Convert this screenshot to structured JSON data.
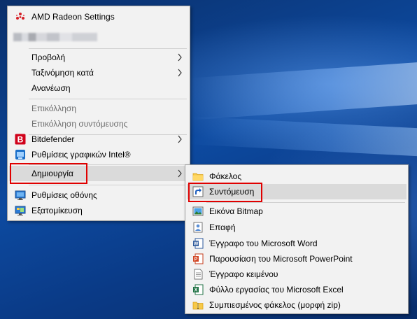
{
  "main_menu": {
    "items": [
      {
        "id": "amd",
        "label": "AMD Radeon Settings",
        "icon": "amd-radeon-icon"
      },
      {
        "id": "view",
        "label": "Προβολή",
        "has_submenu": true
      },
      {
        "id": "sort",
        "label": "Ταξινόμηση κατά",
        "has_submenu": true
      },
      {
        "id": "refresh",
        "label": "Ανανέωση"
      },
      {
        "id": "paste",
        "label": "Επικόλληση",
        "disabled": true
      },
      {
        "id": "paste_shortcut",
        "label": "Επικόλληση συντόμευσης",
        "disabled": true
      },
      {
        "id": "bitdefender",
        "label": "Bitdefender",
        "icon": "bitdefender-icon",
        "has_submenu": true
      },
      {
        "id": "intel",
        "label": "Ρυθμίσεις γραφικών Intel®",
        "icon": "intel-graphics-icon"
      },
      {
        "id": "new",
        "label": "Δημιουργία",
        "has_submenu": true,
        "highlighted": true
      },
      {
        "id": "display",
        "label": "Ρυθμίσεις οθόνης",
        "icon": "display-settings-icon"
      },
      {
        "id": "personalize",
        "label": "Εξατομίκευση",
        "icon": "personalize-icon"
      }
    ]
  },
  "sub_menu": {
    "items": [
      {
        "id": "folder",
        "label": "Φάκελος",
        "icon": "folder-icon"
      },
      {
        "id": "shortcut",
        "label": "Συντόμευση",
        "icon": "shortcut-icon",
        "highlighted": true
      },
      {
        "id": "bitmap",
        "label": "Εικόνα Bitmap",
        "icon": "bitmap-icon"
      },
      {
        "id": "contact",
        "label": "Επαφή",
        "icon": "contact-icon"
      },
      {
        "id": "word",
        "label": "Έγγραφο του Microsoft Word",
        "icon": "word-icon"
      },
      {
        "id": "powerpoint",
        "label": "Παρουσίαση του Microsoft PowerPoint",
        "icon": "powerpoint-icon"
      },
      {
        "id": "text",
        "label": "Έγγραφο κειμένου",
        "icon": "text-document-icon"
      },
      {
        "id": "excel",
        "label": "Φύλλο εργασίας του Microsoft Excel",
        "icon": "excel-icon"
      },
      {
        "id": "zip",
        "label": "Συμπιεσμένος φάκελος (μορφή zip)",
        "icon": "zip-folder-icon"
      }
    ]
  },
  "colors": {
    "menu_bg": "#f2f2f2",
    "highlight": "#dadada",
    "annotation_red": "#e00000",
    "disabled_text": "#6d6d6d"
  }
}
